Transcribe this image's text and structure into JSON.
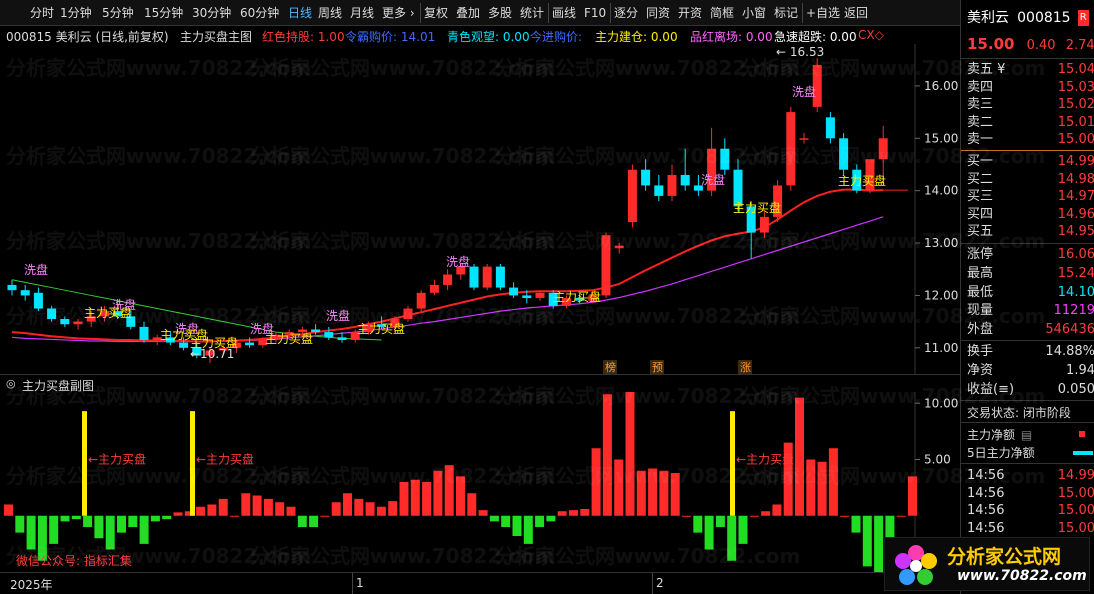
{
  "toolbar": {
    "items": [
      "分时",
      "1分钟",
      "5分钟",
      "15分钟",
      "30分钟",
      "60分钟",
      "日线",
      "周线",
      "月线",
      "更多 ›",
      "复权",
      "叠加",
      "多股",
      "统计",
      "画线",
      "F10",
      "逐分",
      "同资",
      "开资",
      "简框",
      "小窗",
      "标记",
      "+自选",
      "返回"
    ],
    "active_index": 6
  },
  "infobar": {
    "stock": "000815 美利云 (日线,前复权)",
    "indicator": "主力买盘主图",
    "hongse": "红色持股: 1.00",
    "lingjing": "令霸购价: 14.01",
    "qingse": "青色观望: 0.00",
    "jinjin": "今进购价:",
    "zhuli_jiancang": "主力建仓: 0.00",
    "pinhong": "品红离场: 0.00",
    "jisu": "急速超跌: 0.00",
    "cx": "CX◇"
  },
  "price_axis": {
    "ticks": [
      "16.00",
      "15.00",
      "14.00",
      "13.00",
      "12.00",
      "11.00"
    ]
  },
  "sub_axis": {
    "ticks": [
      "10.00",
      "5.00"
    ]
  },
  "sub_header": {
    "title": "主力买盘副图"
  },
  "time_axis": {
    "labels": [
      "2025年",
      "1",
      "2"
    ]
  },
  "annotations": {
    "xipan": "洗盘",
    "zhulimaipan": "主力买盘",
    "high_label": "← 16.53",
    "low_label": "←10.71",
    "bang": "榜",
    "yu": "预",
    "zhang": "涨",
    "sub_zhuli": "主力买盘",
    "wechat": "微信公众号: 指标汇集"
  },
  "watermark": "分析家公式网www.70822.com",
  "right_panel": {
    "name": "美利云",
    "code": "000815",
    "badge": "R",
    "price": "15.00",
    "change": "0.40",
    "change_pct": "2.74%",
    "asks": [
      {
        "label": "卖五 ¥",
        "price": "15.04"
      },
      {
        "label": "卖四",
        "price": "15.03"
      },
      {
        "label": "卖三",
        "price": "15.02"
      },
      {
        "label": "卖二",
        "price": "15.01"
      },
      {
        "label": "卖一",
        "price": "15.00"
      }
    ],
    "bids": [
      {
        "label": "买一",
        "price": "14.99"
      },
      {
        "label": "买二",
        "price": "14.98"
      },
      {
        "label": "买三",
        "price": "14.97"
      },
      {
        "label": "买四",
        "price": "14.96"
      },
      {
        "label": "买五",
        "price": "14.95"
      }
    ],
    "stats": [
      {
        "label": "涨停",
        "value": "16.06",
        "color": "#ff3b3b"
      },
      {
        "label": "最高",
        "value": "15.24",
        "color": "#ff3b3b"
      },
      {
        "label": "最低",
        "value": "14.10",
        "color": "#00e5ff"
      },
      {
        "label": "现量",
        "value": "11219",
        "color": "#ff3bff"
      },
      {
        "label": "外盘",
        "value": "546436",
        "color": "#ff3b3b"
      }
    ],
    "stats2": [
      {
        "label": "换手",
        "value": "14.88%"
      },
      {
        "label": "净资",
        "value": "1.94"
      },
      {
        "label": "收益(≡)",
        "value": "0.050"
      }
    ],
    "trade_status": "交易状态: 闭市阶段",
    "legend1": "主力净额",
    "legend2": "5日主力净额",
    "ticks": [
      {
        "time": "14:56",
        "price": "14.99"
      },
      {
        "time": "14:56",
        "price": "15.00"
      },
      {
        "time": "14:56",
        "price": "15.00"
      },
      {
        "time": "14:56",
        "price": "15.00"
      }
    ]
  },
  "logo": {
    "title": "分析家公式网",
    "url": "www.70822.com"
  },
  "colors": {
    "up": "#ff2a2a",
    "down": "#00e5ff",
    "ma_red": "#ff2020",
    "ma_purple": "#cc33ff",
    "ma_green": "#33cc33",
    "yellow": "#ffee00",
    "green_bar": "#22dd22"
  },
  "chart_data": [
    {
      "type": "candlestick",
      "title": "",
      "ylim": [
        10.5,
        16.8
      ],
      "candles": [
        {
          "o": 12.2,
          "h": 12.3,
          "l": 12.0,
          "c": 12.1
        },
        {
          "o": 12.1,
          "h": 12.2,
          "l": 11.9,
          "c": 12.0
        },
        {
          "o": 12.05,
          "h": 12.15,
          "l": 11.7,
          "c": 11.75
        },
        {
          "o": 11.75,
          "h": 11.8,
          "l": 11.5,
          "c": 11.55
        },
        {
          "o": 11.55,
          "h": 11.6,
          "l": 11.4,
          "c": 11.45
        },
        {
          "o": 11.45,
          "h": 11.55,
          "l": 11.35,
          "c": 11.5
        },
        {
          "o": 11.5,
          "h": 11.7,
          "l": 11.4,
          "c": 11.6
        },
        {
          "o": 11.6,
          "h": 11.8,
          "l": 11.5,
          "c": 11.7
        },
        {
          "o": 11.7,
          "h": 11.9,
          "l": 11.55,
          "c": 11.6
        },
        {
          "o": 11.6,
          "h": 11.7,
          "l": 11.35,
          "c": 11.4
        },
        {
          "o": 11.4,
          "h": 11.5,
          "l": 11.1,
          "c": 11.15
        },
        {
          "o": 11.15,
          "h": 11.25,
          "l": 11.05,
          "c": 11.2
        },
        {
          "o": 11.2,
          "h": 11.3,
          "l": 11.05,
          "c": 11.1
        },
        {
          "o": 11.1,
          "h": 11.2,
          "l": 10.95,
          "c": 11.0
        },
        {
          "o": 11.0,
          "h": 11.1,
          "l": 10.8,
          "c": 10.85
        },
        {
          "o": 10.85,
          "h": 11.0,
          "l": 10.71,
          "c": 10.95
        },
        {
          "o": 10.95,
          "h": 11.05,
          "l": 10.85,
          "c": 11.0
        },
        {
          "o": 11.0,
          "h": 11.15,
          "l": 10.9,
          "c": 11.1
        },
        {
          "o": 11.1,
          "h": 11.2,
          "l": 11.0,
          "c": 11.05
        },
        {
          "o": 11.05,
          "h": 11.2,
          "l": 11.0,
          "c": 11.15
        },
        {
          "o": 11.15,
          "h": 11.3,
          "l": 11.1,
          "c": 11.25
        },
        {
          "o": 11.25,
          "h": 11.35,
          "l": 11.15,
          "c": 11.3
        },
        {
          "o": 11.3,
          "h": 11.4,
          "l": 11.2,
          "c": 11.35
        },
        {
          "o": 11.35,
          "h": 11.45,
          "l": 11.25,
          "c": 11.3
        },
        {
          "o": 11.3,
          "h": 11.4,
          "l": 11.15,
          "c": 11.2
        },
        {
          "o": 11.2,
          "h": 11.3,
          "l": 11.1,
          "c": 11.15
        },
        {
          "o": 11.15,
          "h": 11.35,
          "l": 11.1,
          "c": 11.3
        },
        {
          "o": 11.3,
          "h": 11.5,
          "l": 11.25,
          "c": 11.45
        },
        {
          "o": 11.45,
          "h": 11.6,
          "l": 11.35,
          "c": 11.4
        },
        {
          "o": 11.4,
          "h": 11.6,
          "l": 11.3,
          "c": 11.55
        },
        {
          "o": 11.55,
          "h": 11.8,
          "l": 11.5,
          "c": 11.75
        },
        {
          "o": 11.75,
          "h": 12.1,
          "l": 11.7,
          "c": 12.05
        },
        {
          "o": 12.05,
          "h": 12.3,
          "l": 12.0,
          "c": 12.2
        },
        {
          "o": 12.2,
          "h": 12.5,
          "l": 12.1,
          "c": 12.4
        },
        {
          "o": 12.4,
          "h": 12.6,
          "l": 12.3,
          "c": 12.55
        },
        {
          "o": 12.55,
          "h": 12.6,
          "l": 12.1,
          "c": 12.15
        },
        {
          "o": 12.15,
          "h": 12.6,
          "l": 12.1,
          "c": 12.55
        },
        {
          "o": 12.55,
          "h": 12.6,
          "l": 12.1,
          "c": 12.15
        },
        {
          "o": 12.15,
          "h": 12.25,
          "l": 11.95,
          "c": 12.0
        },
        {
          "o": 12.0,
          "h": 12.1,
          "l": 11.85,
          "c": 11.95
        },
        {
          "o": 11.95,
          "h": 12.1,
          "l": 11.9,
          "c": 12.05
        },
        {
          "o": 12.05,
          "h": 12.1,
          "l": 11.75,
          "c": 11.8
        },
        {
          "o": 11.8,
          "h": 12.0,
          "l": 11.75,
          "c": 11.95
        },
        {
          "o": 11.95,
          "h": 12.05,
          "l": 11.85,
          "c": 11.9
        },
        {
          "o": 11.9,
          "h": 12.1,
          "l": 11.85,
          "c": 12.0
        },
        {
          "o": 12.0,
          "h": 13.2,
          "l": 11.95,
          "c": 13.15
        },
        {
          "o": 12.9,
          "h": 13.0,
          "l": 12.8,
          "c": 12.95
        },
        {
          "o": 13.4,
          "h": 14.5,
          "l": 13.3,
          "c": 14.4
        },
        {
          "o": 14.4,
          "h": 14.6,
          "l": 14.0,
          "c": 14.1
        },
        {
          "o": 14.1,
          "h": 14.3,
          "l": 13.8,
          "c": 13.9
        },
        {
          "o": 13.9,
          "h": 14.5,
          "l": 13.8,
          "c": 14.3
        },
        {
          "o": 14.3,
          "h": 14.8,
          "l": 14.0,
          "c": 14.1
        },
        {
          "o": 14.1,
          "h": 14.3,
          "l": 13.9,
          "c": 14.0
        },
        {
          "o": 14.0,
          "h": 15.2,
          "l": 13.9,
          "c": 14.8
        },
        {
          "o": 14.8,
          "h": 15.0,
          "l": 14.3,
          "c": 14.4
        },
        {
          "o": 14.4,
          "h": 14.6,
          "l": 13.6,
          "c": 13.7
        },
        {
          "o": 13.7,
          "h": 13.8,
          "l": 12.7,
          "c": 13.2
        },
        {
          "o": 13.2,
          "h": 13.6,
          "l": 13.1,
          "c": 13.5
        },
        {
          "o": 13.5,
          "h": 14.2,
          "l": 13.4,
          "c": 14.1
        },
        {
          "o": 14.1,
          "h": 15.6,
          "l": 14.0,
          "c": 15.5
        },
        {
          "o": 15.0,
          "h": 15.1,
          "l": 14.9,
          "c": 15.0
        },
        {
          "o": 15.6,
          "h": 16.53,
          "l": 15.5,
          "c": 16.4
        },
        {
          "o": 15.4,
          "h": 15.5,
          "l": 14.9,
          "c": 15.0
        },
        {
          "o": 15.0,
          "h": 15.1,
          "l": 14.3,
          "c": 14.4
        },
        {
          "o": 14.4,
          "h": 14.5,
          "l": 13.95,
          "c": 14.0
        },
        {
          "o": 14.0,
          "h": 14.6,
          "l": 13.95,
          "c": 14.6
        },
        {
          "o": 14.6,
          "h": 15.24,
          "l": 14.1,
          "c": 15.0
        }
      ],
      "ma_red": [
        11.3,
        11.28,
        11.25,
        11.22,
        11.2,
        11.18,
        11.17,
        11.16,
        11.15,
        11.15,
        11.14,
        11.14,
        11.13,
        11.13,
        11.12,
        11.12,
        11.13,
        11.14,
        11.15,
        11.17,
        11.2,
        11.23,
        11.26,
        11.3,
        11.33,
        11.36,
        11.4,
        11.45,
        11.5,
        11.56,
        11.62,
        11.68,
        11.74,
        11.8,
        11.86,
        11.92,
        11.98,
        12.02,
        12.05,
        12.07,
        12.08,
        12.08,
        12.08,
        12.09,
        12.1,
        12.15,
        12.22,
        12.35,
        12.48,
        12.6,
        12.72,
        12.84,
        12.95,
        13.05,
        13.13,
        13.18,
        13.22,
        13.3,
        13.45,
        13.62,
        13.78,
        13.9,
        13.98,
        14.02,
        14.02,
        14.0,
        14.01
      ],
      "ma_purple": [
        11.2,
        11.18,
        11.17,
        11.16,
        11.15,
        11.14,
        11.13,
        11.13,
        11.12,
        11.12,
        11.12,
        11.12,
        11.12,
        11.12,
        11.12,
        11.12,
        11.13,
        11.13,
        11.14,
        11.15,
        11.17,
        11.19,
        11.21,
        11.23,
        11.25,
        11.28,
        11.3,
        11.33,
        11.36,
        11.4,
        11.43,
        11.47,
        11.5,
        11.54,
        11.58,
        11.62,
        11.66,
        11.7,
        11.73,
        11.76,
        11.78,
        11.8,
        11.82,
        11.84,
        11.87,
        11.91,
        11.96,
        12.02,
        12.08,
        12.15,
        12.22,
        12.3,
        12.38,
        12.46,
        12.54,
        12.62,
        12.7,
        12.78,
        12.86,
        12.94,
        13.02,
        13.1,
        13.18,
        13.26,
        13.34,
        13.42,
        13.5
      ],
      "ma_green": [
        12.3,
        12.25,
        12.2,
        12.15,
        12.1,
        12.05,
        12.0,
        11.95,
        11.9,
        11.85,
        11.8,
        11.75,
        11.7,
        11.65,
        11.6,
        11.55,
        11.5,
        11.45,
        11.4,
        11.35,
        11.3,
        11.27,
        11.24,
        11.22,
        11.2,
        11.18,
        11.17,
        11.16,
        11.15
      ]
    },
    {
      "type": "bar",
      "title": "",
      "ylim": [
        -5,
        11
      ],
      "values": [
        1,
        -1.5,
        -3,
        -4,
        -2.5,
        -0.5,
        -0.3,
        -1,
        -2,
        -3,
        -1.5,
        -1,
        -2.5,
        -0.5,
        -0.3,
        0.3,
        0.4,
        0.8,
        1,
        1.5,
        0,
        2,
        1.8,
        1.5,
        1.2,
        0.8,
        -1,
        -1,
        0,
        1.2,
        2,
        1.5,
        1.2,
        0.8,
        1.3,
        3,
        3.2,
        3,
        4,
        4.5,
        3.5,
        2,
        0.5,
        -0.5,
        -1,
        -1.8,
        -2.5,
        -1,
        -0.5,
        0.4,
        0.5,
        0.6,
        6,
        10.8,
        5,
        11.2,
        4,
        4.2,
        4,
        3.8,
        0,
        -1.5,
        -3,
        -1,
        -4,
        -2.5,
        0,
        0.4,
        1,
        6.5,
        10.5,
        5,
        4.8,
        6,
        0,
        -1.5,
        -4.5,
        -5,
        -2,
        0,
        3.5
      ],
      "yellow_markers": [
        5,
        12,
        48
      ]
    }
  ]
}
